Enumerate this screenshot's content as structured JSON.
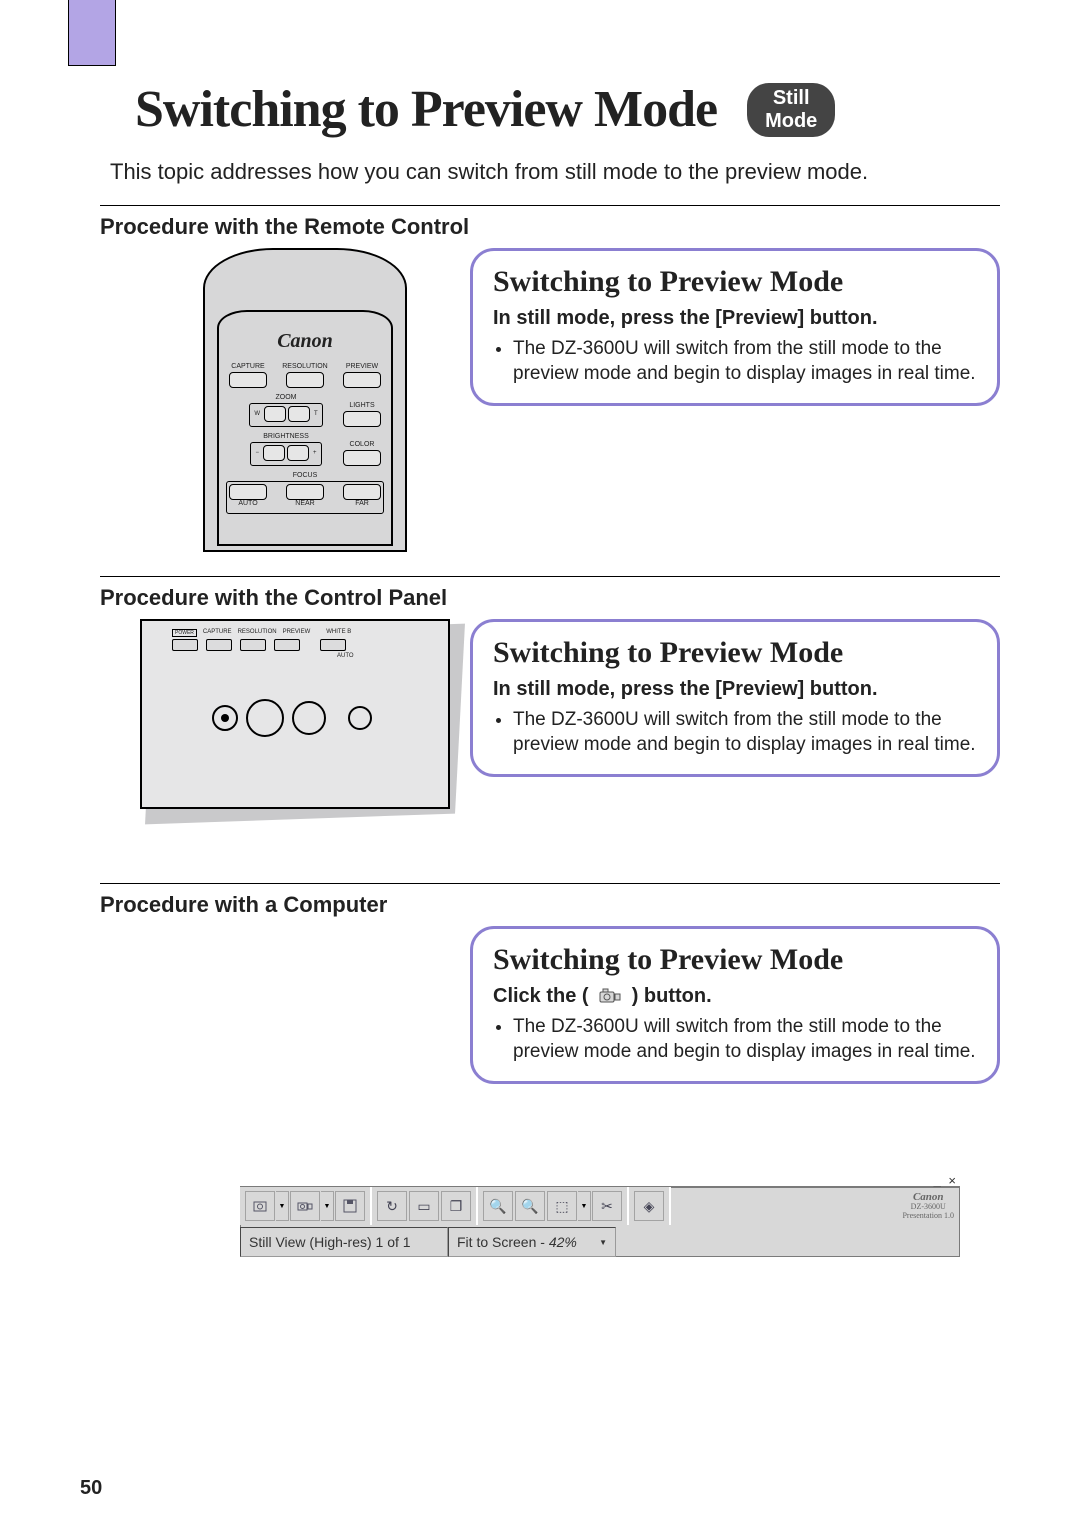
{
  "header": {
    "title": "Switching to Preview Mode",
    "mode_pill_line1": "Still",
    "mode_pill_line2": "Mode"
  },
  "intro": "This topic addresses how you can switch from still mode to the preview mode.",
  "sections": {
    "remote": {
      "heading": "Procedure with the Remote Control",
      "brand": "Canon",
      "labels": {
        "capture": "CAPTURE",
        "resolution": "RESOLUTION",
        "preview": "PREVIEW",
        "zoom": "ZOOM",
        "w": "W",
        "t": "T",
        "lights": "LIGHTS",
        "brightness": "BRIGHTNESS",
        "minus": "−",
        "plus": "+",
        "color": "COLOR",
        "focus": "FOCUS",
        "auto": "AUTO",
        "near": "NEAR",
        "far": "FAR"
      },
      "callout": {
        "title": "Switching to Preview Mode",
        "sub": "In still mode, press the [Preview] button.",
        "bullet": "The DZ-3600U will switch from the still mode to the preview mode and begin to display images in real time."
      }
    },
    "panel": {
      "heading": "Procedure with the Control Panel",
      "labels": {
        "power": "POWER",
        "capture": "CAPTURE",
        "resolution": "RESOLUTION",
        "preview": "PREVIEW",
        "whiteb": "WHITE B",
        "auto": "AUTO"
      },
      "callout": {
        "title": "Switching to Preview Mode",
        "sub": "In still mode, press the [Preview] button.",
        "bullet": "The DZ-3600U will switch from the still mode to the preview mode and begin to display images in real time."
      }
    },
    "computer": {
      "heading": "Procedure with a Computer",
      "callout": {
        "title": "Switching to Preview Mode",
        "sub_prefix": "Click the ( ",
        "sub_suffix": " ) button.",
        "icon_name": "preview-icon",
        "bullet": "The DZ-3600U will switch from the still mode to the preview mode and begin to display images in real time."
      },
      "toolbar": {
        "brand": "Canon",
        "model": "DZ-3600U",
        "app": "Presentation 1.0",
        "status_left": "Still View (High-res) 1 of 1",
        "status_right_label": "Fit to Screen -",
        "status_right_value": "42%",
        "win_controls": "_  ×"
      }
    }
  },
  "page_number": "50"
}
